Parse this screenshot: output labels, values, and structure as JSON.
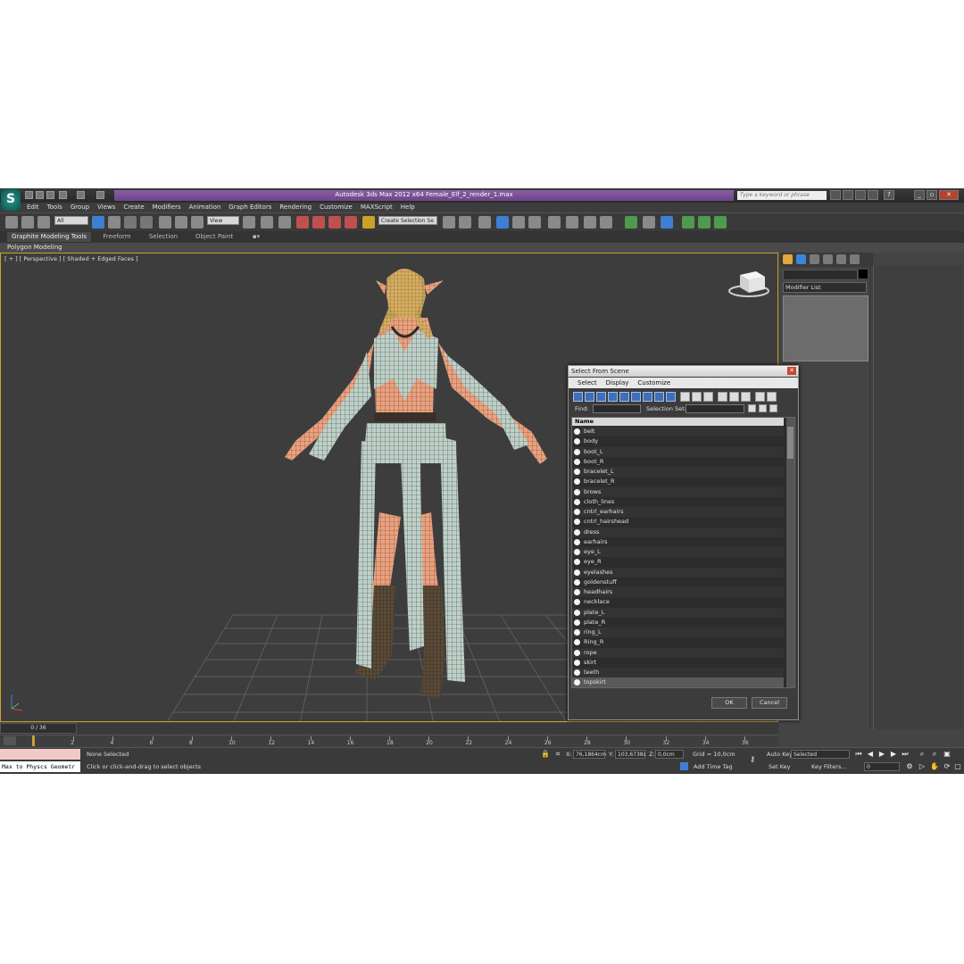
{
  "titlebar": {
    "title": "Autodesk 3ds Max  2012 x64      Female_Elf_2_render_1.max",
    "search_placeholder": "Type a keyword or phrase"
  },
  "menu": [
    "Edit",
    "Tools",
    "Group",
    "Views",
    "Create",
    "Modifiers",
    "Animation",
    "Graph Editors",
    "Rendering",
    "Customize",
    "MAXScript",
    "Help"
  ],
  "toolbar": {
    "filter_value": "All",
    "refcoord_value": "View",
    "selection_set_value": "Create Selection Se"
  },
  "ribbon": {
    "tabs": [
      "Graphite Modeling Tools",
      "Freeform",
      "Selection",
      "Object Paint"
    ],
    "sub_label": "Polygon Modeling"
  },
  "viewport": {
    "label": "[ + ] [ Perspective ] [ Shaded + Edged Faces ]"
  },
  "command_panel": {
    "modifier_list": "Modifier List"
  },
  "dialog": {
    "title": "Select From Scene",
    "menu": [
      "Select",
      "Display",
      "Customize"
    ],
    "find_label": "Find:",
    "selset_label": "Selection Set:",
    "column_header": "Name",
    "items": [
      "belt",
      "body",
      "boot_L",
      "boot_R",
      "bracelet_L",
      "bracelet_R",
      "brows",
      "cloth_lines",
      "cntrl_earhairs",
      "cntrl_hairshead",
      "dress",
      "earhairs",
      "eye_L",
      "eye_R",
      "eyelashes",
      "goldenstuff",
      "headhairs",
      "necklace",
      "plate_L",
      "plate_R",
      "ring_L",
      "Ring_R",
      "rope",
      "skirt",
      "teeth",
      "topskirt"
    ],
    "ok_label": "OK",
    "cancel_label": "Cancel"
  },
  "timeline": {
    "frame_label": "0 / 36",
    "ticks": [
      "0",
      "2",
      "4",
      "6",
      "8",
      "10",
      "12",
      "14",
      "16",
      "18",
      "20",
      "22",
      "24",
      "26",
      "28",
      "30",
      "32",
      "34",
      "36"
    ]
  },
  "status": {
    "maxscript_text": "Max to Physcs Geometr",
    "selected_text": "None Selected",
    "prompt_text": "Click or click-and-drag to select objects",
    "x_label": "X:",
    "x_value": "76,1864cm",
    "y_label": "Y:",
    "y_value": "103,6738c",
    "z_label": "Z:",
    "z_value": "0,0cm",
    "grid_text": "Grid = 10,0cm",
    "add_time_tag": "Add Time Tag",
    "auto_key": "Auto Key",
    "set_key": "Set Key",
    "selected_dropdown": "Selected",
    "key_filters": "Key Filters...",
    "frame_value": "0"
  }
}
